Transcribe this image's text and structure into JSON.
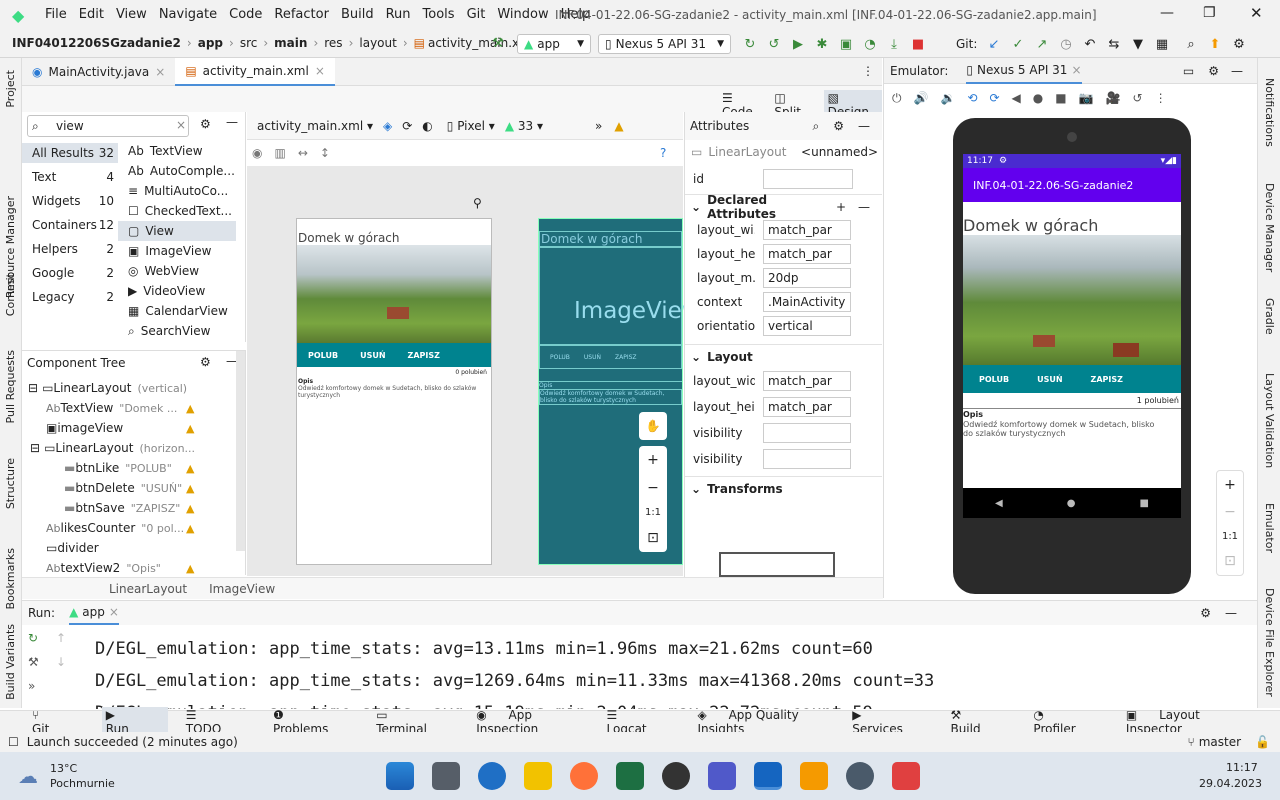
{
  "titlebar": {
    "menu": [
      "File",
      "Edit",
      "View",
      "Navigate",
      "Code",
      "Refactor",
      "Build",
      "Run",
      "Tools",
      "Git",
      "Window",
      "Help"
    ],
    "title": "INF.04-01-22.06-SG-zadanie2 - activity_main.xml [INF.04-01-22.06-SG-zadanie2.app.main]"
  },
  "nav": {
    "crumbs": [
      "INF04012206SGzadanie2",
      "app",
      "src",
      "main",
      "res",
      "layout",
      "activity_main.xml"
    ],
    "run_config": "app",
    "device": "Nexus 5 API 31",
    "git": "Git:"
  },
  "tabs": [
    {
      "label": "MainActivity.java"
    },
    {
      "label": "activity_main.xml"
    }
  ],
  "modes": {
    "code": "Code",
    "split": "Split",
    "design": "Design"
  },
  "left_strip": [
    "Project",
    "Resource Manager",
    "Commit",
    "Pull Requests",
    "Structure",
    "Bookmarks",
    "Build Variants"
  ],
  "right_strip": [
    "Notifications",
    "Device Manager",
    "Gradle",
    "Layout Validation",
    "Emulator",
    "Device File Explorer"
  ],
  "palette": {
    "search": "view",
    "categories": [
      {
        "name": "All Results",
        "count": "32"
      },
      {
        "name": "Text",
        "count": "4"
      },
      {
        "name": "Widgets",
        "count": "10"
      },
      {
        "name": "Containers",
        "count": "12"
      },
      {
        "name": "Helpers",
        "count": "2"
      },
      {
        "name": "Google",
        "count": "2"
      },
      {
        "name": "Legacy",
        "count": "2"
      }
    ],
    "items": [
      {
        "icon": "Ab",
        "label": "TextView"
      },
      {
        "icon": "Ab",
        "label": "AutoComple..."
      },
      {
        "icon": "≡",
        "label": "MultiAutoCo..."
      },
      {
        "icon": "☐",
        "label": "CheckedText..."
      },
      {
        "icon": "▢",
        "label": "View"
      },
      {
        "icon": "▣",
        "label": "ImageView"
      },
      {
        "icon": "◎",
        "label": "WebView"
      },
      {
        "icon": "▶",
        "label": "VideoView"
      },
      {
        "icon": "▦",
        "label": "CalendarView"
      },
      {
        "icon": "⌕",
        "label": "SearchView"
      }
    ]
  },
  "component_tree": {
    "title": "Component Tree",
    "nodes": [
      {
        "label": "LinearLayout",
        "hint": "(vertical)"
      },
      {
        "label": "TextView",
        "hint": "\"Domek ..."
      },
      {
        "label": "imageView",
        "hint": ""
      },
      {
        "label": "LinearLayout",
        "hint": "(horizon..."
      },
      {
        "label": "btnLike",
        "hint": "\"POLUB\""
      },
      {
        "label": "btnDelete",
        "hint": "\"USUŃ\""
      },
      {
        "label": "btnSave",
        "hint": "\"ZAPISZ\""
      },
      {
        "label": "likesCounter",
        "hint": "\"0 pol..."
      },
      {
        "label": "divider",
        "hint": ""
      },
      {
        "label": "textView2",
        "hint": "\"Opis\""
      }
    ]
  },
  "design_toolbar": {
    "file": "activity_main.xml",
    "device": "Pixel",
    "api": "33"
  },
  "preview": {
    "title": "Domek w górach",
    "buttons": [
      "POLUB",
      "USUŃ",
      "ZAPISZ"
    ],
    "counter": "0 polubień",
    "opis": "Opis",
    "desc": "Odwiedź komfortowy domek w Sudetach, blisko do szlaków turystycznych",
    "blueprint_image": "ImageView",
    "zoom_fit": "1:1"
  },
  "attributes": {
    "title": "Attributes",
    "element": "LinearLayout",
    "name": "<unnamed>",
    "id_label": "id",
    "declared": "Declared Attributes",
    "declared_rows": [
      {
        "k": "layout_wi...",
        "v": "match_par"
      },
      {
        "k": "layout_he...",
        "v": "match_par"
      },
      {
        "k": "layout_m...",
        "v": "20dp"
      },
      {
        "k": "context",
        "v": ".MainActivity"
      },
      {
        "k": "orientation",
        "v": "vertical"
      }
    ],
    "layout": "Layout",
    "layout_rows": [
      {
        "k": "layout_wid...",
        "v": "match_par"
      },
      {
        "k": "layout_hei...",
        "v": "match_par"
      },
      {
        "k": "visibility",
        "v": ""
      },
      {
        "k": "visibility",
        "v": ""
      }
    ],
    "transforms": "Transforms"
  },
  "breadcrumb": [
    "LinearLayout",
    "ImageView"
  ],
  "emulator": {
    "label": "Emulator:",
    "tab": "Nexus 5 API 31",
    "time": "11:17",
    "app_title": "INF.04-01-22.06-SG-zadanie2",
    "heading": "Domek w górach",
    "buttons": [
      "POLUB",
      "USUŃ",
      "ZAPISZ"
    ],
    "counter": "1 polubień",
    "opis": "Opis",
    "desc": "Odwiedź komfortowy domek w Sudetach, blisko do szlaków turystycznych",
    "zoom": "1:1"
  },
  "run": {
    "label": "Run:",
    "config": "app",
    "lines": [
      "D/EGL_emulation: app_time_stats: avg=13.11ms min=1.96ms max=21.62ms count=60",
      "D/EGL_emulation: app_time_stats: avg=1269.64ms min=11.33ms max=41368.20ms count=33",
      "D/EGL_emulation: app_time_stats: avg=15.19ms min=2.04ms max=22.72ms count=59"
    ]
  },
  "bottom_tabs": [
    "Git",
    "Run",
    "TODO",
    "Problems",
    "Terminal",
    "App Inspection",
    "Logcat",
    "App Quality Insights",
    "Services",
    "Build",
    "Profiler"
  ],
  "layout_inspector": "Layout Inspector",
  "status": {
    "message": "Launch succeeded (2 minutes ago)",
    "branch": "master"
  },
  "taskbar": {
    "temp": "13°C",
    "weather": "Pochmurnie",
    "time": "11:17",
    "date": "29.04.2023"
  },
  "colors": {
    "teal": "#00838f",
    "purple": "#6200ee",
    "accent": "#4a8ed8"
  }
}
